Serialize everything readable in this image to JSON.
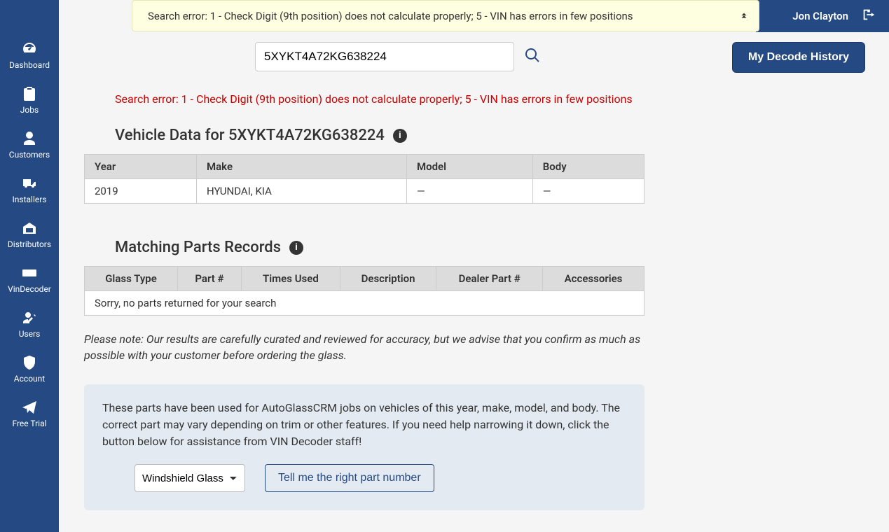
{
  "sidebar": {
    "items": [
      {
        "label": "Dashboard"
      },
      {
        "label": "Jobs"
      },
      {
        "label": "Customers"
      },
      {
        "label": "Installers"
      },
      {
        "label": "Distributors"
      },
      {
        "label": "VinDecoder"
      },
      {
        "label": "Users"
      },
      {
        "label": "Account"
      },
      {
        "label": "Free Trial"
      }
    ]
  },
  "banner": {
    "text": "Search error: 1 - Check Digit (9th position) does not calculate properly; 5 - VIN has errors in few positions"
  },
  "topbar": {
    "user": "Jon Clayton"
  },
  "history_button": "My Decode History",
  "search": {
    "value": "5XYKT4A72KG638224"
  },
  "error_text": "Search error: 1 - Check Digit (9th position) does not calculate properly; 5 - VIN has errors in few positions",
  "vehicle_data": {
    "title": "Vehicle Data for 5XYKT4A72KG638224",
    "headers": {
      "year": "Year",
      "make": "Make",
      "model": "Model",
      "body": "Body"
    },
    "row": {
      "year": "2019",
      "make": "HYUNDAI, KIA",
      "model": "—",
      "body": "—"
    }
  },
  "parts": {
    "title": "Matching Parts Records",
    "headers": {
      "glass": "Glass Type",
      "part": "Part #",
      "times": "Times Used",
      "desc": "Description",
      "dealer": "Dealer Part #",
      "acc": "Accessories"
    },
    "empty": "Sorry, no parts returned for your search"
  },
  "note": "Please note: Our results are carefully curated and reviewed for accuracy, but we advise that you confirm as much as possible with your customer before ordering the glass.",
  "help": {
    "text": "These parts have been used for AutoGlassCRM jobs on vehicles of this year, make, model, and body. The correct part may vary depending on trim or other features. If you need help narrowing it down, click the button below for assistance from VIN Decoder staff!",
    "select_value": "Windshield Glass",
    "button": "Tell me the right part number"
  }
}
